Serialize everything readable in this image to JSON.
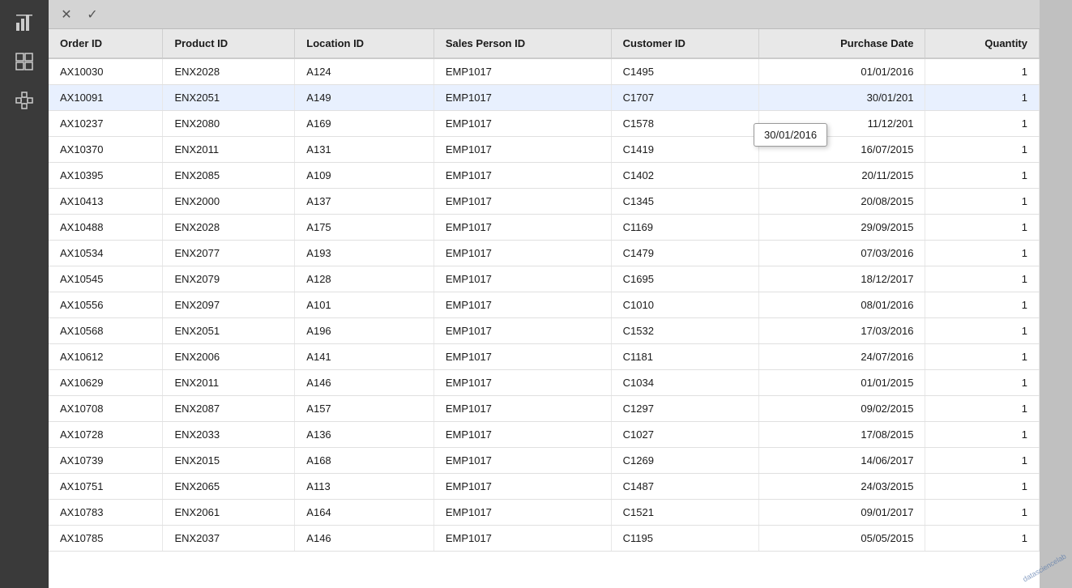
{
  "toolbar": {
    "cancel_label": "✕",
    "confirm_label": "✓"
  },
  "sidebar": {
    "icons": [
      {
        "name": "chart-icon",
        "symbol": "📊"
      },
      {
        "name": "grid-icon",
        "symbol": "⊞"
      },
      {
        "name": "diagram-icon",
        "symbol": "❖"
      }
    ]
  },
  "table": {
    "columns": [
      {
        "key": "order_id",
        "label": "Order ID"
      },
      {
        "key": "product_id",
        "label": "Product ID"
      },
      {
        "key": "location_id",
        "label": "Location ID"
      },
      {
        "key": "sales_person_id",
        "label": "Sales Person ID"
      },
      {
        "key": "customer_id",
        "label": "Customer ID"
      },
      {
        "key": "purchase_date",
        "label": "Purchase Date"
      },
      {
        "key": "quantity",
        "label": "Quantity"
      }
    ],
    "rows": [
      {
        "order_id": "AX10030",
        "product_id": "ENX2028",
        "location_id": "A124",
        "sales_person_id": "EMP1017",
        "customer_id": "C1495",
        "purchase_date": "01/01/2016",
        "quantity": "1"
      },
      {
        "order_id": "AX10091",
        "product_id": "ENX2051",
        "location_id": "A149",
        "sales_person_id": "EMP1017",
        "customer_id": "C1707",
        "purchase_date": "30/01/201",
        "quantity": "1",
        "highlighted": true
      },
      {
        "order_id": "AX10237",
        "product_id": "ENX2080",
        "location_id": "A169",
        "sales_person_id": "EMP1017",
        "customer_id": "C1578",
        "purchase_date": "11/12/201",
        "quantity": "1"
      },
      {
        "order_id": "AX10370",
        "product_id": "ENX2011",
        "location_id": "A131",
        "sales_person_id": "EMP1017",
        "customer_id": "C1419",
        "purchase_date": "16/07/2015",
        "quantity": "1"
      },
      {
        "order_id": "AX10395",
        "product_id": "ENX2085",
        "location_id": "A109",
        "sales_person_id": "EMP1017",
        "customer_id": "C1402",
        "purchase_date": "20/11/2015",
        "quantity": "1"
      },
      {
        "order_id": "AX10413",
        "product_id": "ENX2000",
        "location_id": "A137",
        "sales_person_id": "EMP1017",
        "customer_id": "C1345",
        "purchase_date": "20/08/2015",
        "quantity": "1"
      },
      {
        "order_id": "AX10488",
        "product_id": "ENX2028",
        "location_id": "A175",
        "sales_person_id": "EMP1017",
        "customer_id": "C1169",
        "purchase_date": "29/09/2015",
        "quantity": "1"
      },
      {
        "order_id": "AX10534",
        "product_id": "ENX2077",
        "location_id": "A193",
        "sales_person_id": "EMP1017",
        "customer_id": "C1479",
        "purchase_date": "07/03/2016",
        "quantity": "1"
      },
      {
        "order_id": "AX10545",
        "product_id": "ENX2079",
        "location_id": "A128",
        "sales_person_id": "EMP1017",
        "customer_id": "C1695",
        "purchase_date": "18/12/2017",
        "quantity": "1"
      },
      {
        "order_id": "AX10556",
        "product_id": "ENX2097",
        "location_id": "A101",
        "sales_person_id": "EMP1017",
        "customer_id": "C1010",
        "purchase_date": "08/01/2016",
        "quantity": "1"
      },
      {
        "order_id": "AX10568",
        "product_id": "ENX2051",
        "location_id": "A196",
        "sales_person_id": "EMP1017",
        "customer_id": "C1532",
        "purchase_date": "17/03/2016",
        "quantity": "1"
      },
      {
        "order_id": "AX10612",
        "product_id": "ENX2006",
        "location_id": "A141",
        "sales_person_id": "EMP1017",
        "customer_id": "C1181",
        "purchase_date": "24/07/2016",
        "quantity": "1"
      },
      {
        "order_id": "AX10629",
        "product_id": "ENX2011",
        "location_id": "A146",
        "sales_person_id": "EMP1017",
        "customer_id": "C1034",
        "purchase_date": "01/01/2015",
        "quantity": "1"
      },
      {
        "order_id": "AX10708",
        "product_id": "ENX2087",
        "location_id": "A157",
        "sales_person_id": "EMP1017",
        "customer_id": "C1297",
        "purchase_date": "09/02/2015",
        "quantity": "1"
      },
      {
        "order_id": "AX10728",
        "product_id": "ENX2033",
        "location_id": "A136",
        "sales_person_id": "EMP1017",
        "customer_id": "C1027",
        "purchase_date": "17/08/2015",
        "quantity": "1"
      },
      {
        "order_id": "AX10739",
        "product_id": "ENX2015",
        "location_id": "A168",
        "sales_person_id": "EMP1017",
        "customer_id": "C1269",
        "purchase_date": "14/06/2017",
        "quantity": "1"
      },
      {
        "order_id": "AX10751",
        "product_id": "ENX2065",
        "location_id": "A113",
        "sales_person_id": "EMP1017",
        "customer_id": "C1487",
        "purchase_date": "24/03/2015",
        "quantity": "1"
      },
      {
        "order_id": "AX10783",
        "product_id": "ENX2061",
        "location_id": "A164",
        "sales_person_id": "EMP1017",
        "customer_id": "C1521",
        "purchase_date": "09/01/2017",
        "quantity": "1"
      },
      {
        "order_id": "AX10785",
        "product_id": "ENX2037",
        "location_id": "A146",
        "sales_person_id": "EMP1017",
        "customer_id": "C1195",
        "purchase_date": "05/05/2015",
        "quantity": "1"
      }
    ]
  },
  "tooltip": {
    "text": "30/01/2016"
  }
}
